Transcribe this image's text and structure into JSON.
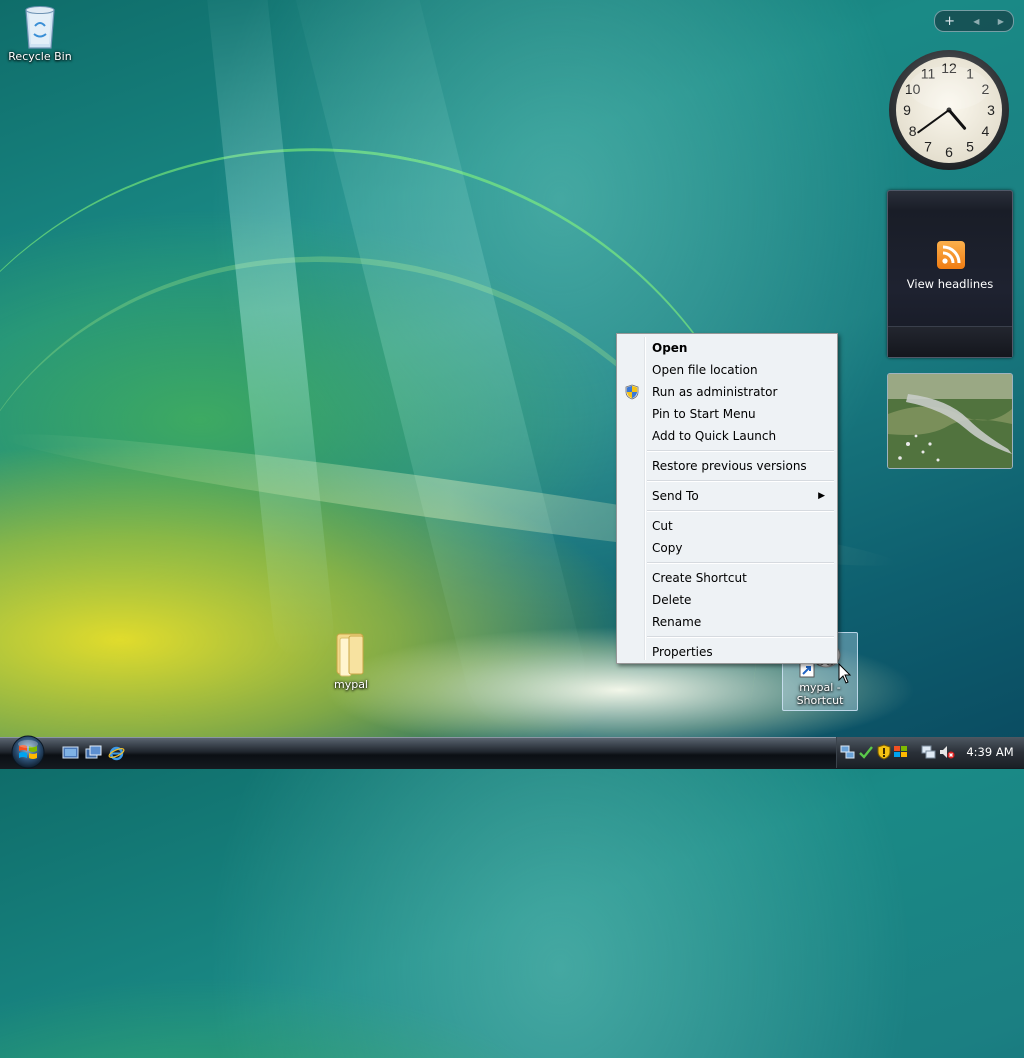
{
  "desktop": {
    "icons": [
      {
        "label": "Recycle Bin",
        "icon": "recycle-bin-icon"
      },
      {
        "label": "mypal",
        "icon": "folder-icon"
      },
      {
        "label": "mypal - Shortcut",
        "icon": "shortcut-icon"
      }
    ]
  },
  "gadgets": {
    "toolbar": {
      "add": "+",
      "prev": "◀",
      "next": "▶"
    },
    "clock": {
      "hour": 4,
      "minute": 39
    },
    "feeds": {
      "label": "View headlines",
      "icon": "rss-icon"
    },
    "slideshow": {
      "icon": "landscape-photo"
    }
  },
  "context_menu": {
    "items": [
      {
        "label": "Open",
        "bold": true
      },
      {
        "label": "Open file location"
      },
      {
        "label": "Run as administrator",
        "icon": "uac-shield-icon"
      },
      {
        "label": "Pin to Start Menu"
      },
      {
        "label": "Add to Quick Launch"
      },
      {
        "label": "Restore previous versions"
      },
      {
        "label": "Send To",
        "submenu": true
      },
      {
        "label": "Cut"
      },
      {
        "label": "Copy"
      },
      {
        "label": "Create Shortcut"
      },
      {
        "label": "Delete"
      },
      {
        "label": "Rename"
      },
      {
        "label": "Properties"
      }
    ]
  },
  "taskbar": {
    "start_icon": "windows-logo-icon",
    "quick_launch": [
      "show-desktop-icon",
      "switch-windows-icon",
      "internet-explorer-icon"
    ],
    "tray_icons": [
      "network-activity-icon",
      "windows-defender-icon",
      "security-shield-icon",
      "windows-update-icon",
      "network-icon",
      "volume-muted-icon"
    ],
    "clock": "4:39 AM"
  },
  "colors": {
    "menu_bg": "#eef2f5",
    "taskbar": "#151a20",
    "accent_green": "#7fe86a"
  }
}
